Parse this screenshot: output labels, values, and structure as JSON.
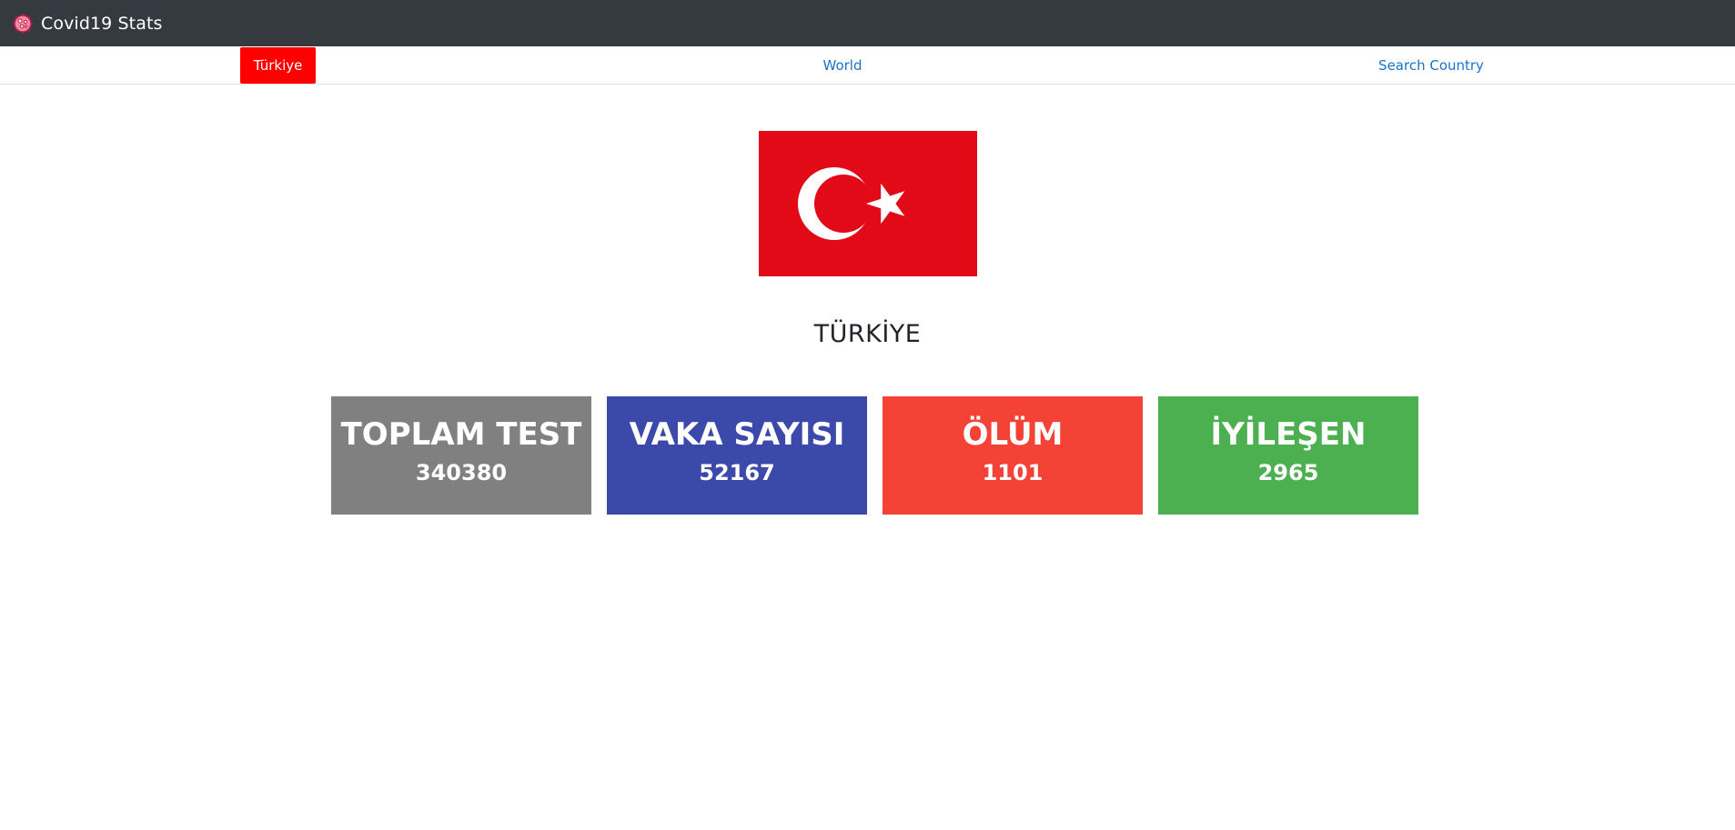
{
  "app": {
    "brand_title": "Covid19 Stats",
    "brand_icon": "virus-icon"
  },
  "nav": {
    "items": [
      {
        "label": "Türkiye",
        "active": true
      },
      {
        "label": "World",
        "active": false
      },
      {
        "label": "Search Country",
        "active": false
      }
    ],
    "active_color": "#ff0000",
    "link_color": "#1a73c8"
  },
  "country": {
    "name": "TÜRKİYE",
    "flag": "turkey-flag"
  },
  "stats": [
    {
      "label": "TOPLAM TEST",
      "value": "340380",
      "color": "#808080"
    },
    {
      "label": "VAKA SAYISI",
      "value": "52167",
      "color": "#3b49ab"
    },
    {
      "label": "ÖLÜM",
      "value": "1101",
      "color": "#f44336"
    },
    {
      "label": "İYİLEŞEN",
      "value": "2965",
      "color": "#4caf50"
    }
  ]
}
